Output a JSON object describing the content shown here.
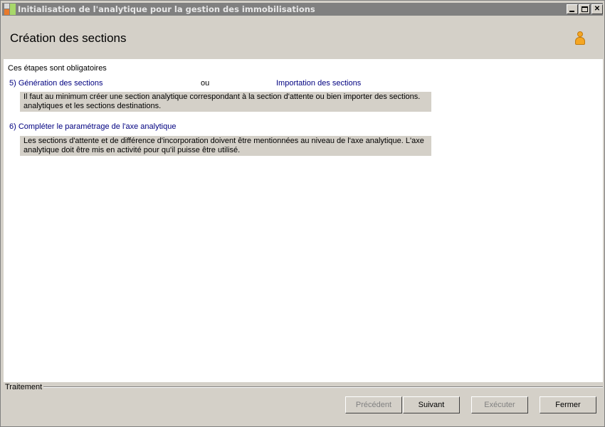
{
  "window": {
    "title": "Initialisation de l'analytique pour la gestion des immobilisations"
  },
  "header": {
    "title": "Création des sections",
    "icon": "user-icon"
  },
  "content": {
    "intro": "Ces étapes sont obligatoires",
    "step5": {
      "link_generation": "5) Génération des sections",
      "or": "ou",
      "link_import": "Importation des sections",
      "note_line1": "Il faut au minimum créer une section analytique correspondant à la section d'attente ou bien importer des sections.",
      "note_line2": "analytiques et les sections destinations."
    },
    "step6": {
      "link": "6) Compléter le paramétrage de l'axe analytique",
      "note_line1": "Les sections d'attente et de différence d'incorporation doivent être mentionnées au niveau de l'axe analytique. L'axe",
      "note_line2": "analytique doit être mis en activité pour qu'il puisse être utilisé."
    }
  },
  "footer": {
    "group_label": "Traitement",
    "buttons": {
      "previous": "Précédent",
      "next": "Suivant",
      "execute": "Exécuter",
      "close": "Fermer"
    }
  },
  "colors": {
    "link": "#000080",
    "panel": "#d4d0c8",
    "titlebar": "#808080",
    "user_icon": "#f5a623"
  }
}
